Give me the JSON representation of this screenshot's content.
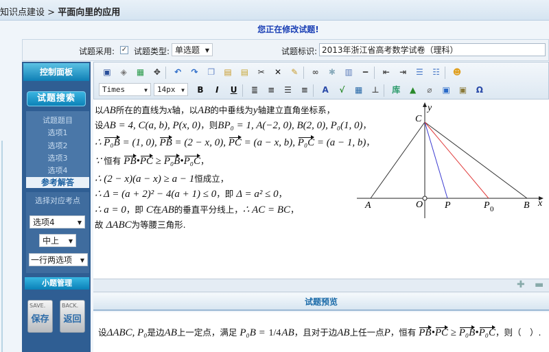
{
  "breadcrumb": {
    "parent": "知识点建设",
    "separator": " > ",
    "current": "平面向里的应用"
  },
  "page_title": "您正在修改试题!",
  "form": {
    "adopt_label": "试题采用:",
    "adopt_checked": true,
    "check_glyph": "✓",
    "type_label": "试题类型:",
    "type_value": "单选题",
    "id_label": "试题标识:",
    "id_value": "2013年浙江省高考数学试卷（理科）"
  },
  "sidebar": {
    "header": "控制面板",
    "search_button": "试题搜索",
    "items": [
      "试题题目",
      "选项1",
      "选项2",
      "选项3",
      "选项4"
    ],
    "active_item": "参考解答",
    "kp_label": "选择对应考点",
    "select_option": "选项4",
    "select_difficulty": "中上",
    "select_layout": "一行两选项",
    "sub_header": "小题管理",
    "save": {
      "en": "SAVE.",
      "cn": "保存"
    },
    "back": {
      "en": "BACK.",
      "cn": "返回"
    }
  },
  "toolbar": {
    "row1": [
      "save-icon",
      "source-icon",
      "preview-icon",
      "fullscreen-icon",
      "|",
      "undo-icon",
      "redo-icon",
      "copy-icon",
      "paste-icon",
      "paste-text-icon",
      "cut-icon",
      "delete-icon",
      "clear-format-icon",
      "|",
      "link-icon",
      "unlink-icon",
      "table-icon",
      "horizontal-rule-icon",
      "|",
      "outdent-icon",
      "indent-icon",
      "ordered-list-icon",
      "unordered-list-icon",
      "|",
      "emoticon-icon"
    ],
    "font_family": "Times",
    "font_size": "14px",
    "row2": [
      "bold-icon",
      "italic-icon",
      "underline-icon",
      "|",
      "justify-icon",
      "align-center-icon",
      "align-left-icon",
      "align-right-icon",
      "|",
      "font-color-icon",
      "formula-icon",
      "image-grid-icon",
      "page-break-icon",
      "|",
      "library-icon",
      "insert-image-icon",
      "attachment-icon",
      "media-icon",
      "picture-icon",
      "special-char-icon"
    ]
  },
  "solution_lines": [
    [
      [
        "c",
        "以"
      ],
      [
        "m",
        "AB"
      ],
      [
        "c",
        "所在的直线为"
      ],
      [
        "m",
        "x"
      ],
      [
        "c",
        "轴，以"
      ],
      [
        "m",
        "AB"
      ],
      [
        "c",
        "的中垂线为"
      ],
      [
        "m",
        "y"
      ],
      [
        "c",
        "轴建立直角坐标系，"
      ]
    ],
    [
      [
        "c",
        "设"
      ],
      [
        "m",
        "AB = 4, C(a, b), P(x, 0)"
      ],
      [
        "c",
        "，则"
      ],
      [
        "m",
        "BP₀ = 1, A(−2, 0), B(2, 0), P₀(1, 0)"
      ],
      [
        "c",
        "，"
      ]
    ],
    [
      [
        "m",
        "∴ "
      ],
      [
        "v",
        "P₀B"
      ],
      [
        "m",
        " = (1, 0), "
      ],
      [
        "v",
        "PB"
      ],
      [
        "m",
        " = (2 − x, 0), "
      ],
      [
        "v",
        "PC"
      ],
      [
        "m",
        " = (a − x, b), "
      ],
      [
        "v",
        "P₀C"
      ],
      [
        "m",
        " = (a − 1, b)"
      ],
      [
        "c",
        "，"
      ]
    ],
    [
      [
        "m",
        "∵ "
      ],
      [
        "c",
        "恒有 "
      ],
      [
        "v",
        "PB"
      ],
      [
        "m",
        "•"
      ],
      [
        "v",
        "PC"
      ],
      [
        "m",
        " ≥ "
      ],
      [
        "v",
        "P₀B"
      ],
      [
        "m",
        "•"
      ],
      [
        "v",
        "P₀C"
      ],
      [
        "c",
        "，"
      ]
    ],
    [
      [
        "m",
        "∴ (2 − x)(a − x) ≥ a − 1"
      ],
      [
        "c",
        "恒成立，"
      ]
    ],
    [
      [
        "m",
        "∴ Δ = (a + 2)² − 4(a + 1) ≤ 0"
      ],
      [
        "c",
        "，即 "
      ],
      [
        "m",
        "Δ = a² ≤ 0"
      ],
      [
        "c",
        "，"
      ]
    ],
    [
      [
        "m",
        "∴ a = 0"
      ],
      [
        "c",
        "，即 "
      ],
      [
        "m",
        "C"
      ],
      [
        "c",
        "在"
      ],
      [
        "m",
        "AB"
      ],
      [
        "c",
        "的垂直平分线上，"
      ],
      [
        "m",
        "∴ AC = BC"
      ],
      [
        "c",
        "，"
      ]
    ],
    [
      [
        "c",
        "故 "
      ],
      [
        "m",
        "ΔABC"
      ],
      [
        "c",
        "为等腰三角形."
      ]
    ]
  ],
  "figure": {
    "labels": {
      "A": "A",
      "O": "O",
      "P": "P",
      "P0": "P",
      "P0_sub": "0",
      "B": "B",
      "C": "C",
      "x": "x",
      "y": "y"
    },
    "colors": {
      "PC": "#3a3ad0",
      "P0C": "#e03a3a",
      "triangle": "#333333"
    }
  },
  "preview": {
    "header": "试题预览",
    "question": [
      [
        "c",
        "设"
      ],
      [
        "m",
        "ΔABC, P₀"
      ],
      [
        "c",
        "是边"
      ],
      [
        "m",
        "AB"
      ],
      [
        "c",
        "上一定点，满足 "
      ],
      [
        "m",
        "P₀B = "
      ],
      [
        "f",
        "1/4"
      ],
      [
        "m",
        "AB"
      ],
      [
        "c",
        "，且对于边"
      ],
      [
        "m",
        "AB"
      ],
      [
        "c",
        "上任一点"
      ],
      [
        "m",
        "P"
      ],
      [
        "c",
        "，恒有 "
      ],
      [
        "v",
        "PB"
      ],
      [
        "m",
        "•"
      ],
      [
        "v",
        "PC"
      ],
      [
        "m",
        " ≥ "
      ],
      [
        "v",
        "P₀B"
      ],
      [
        "m",
        "•"
      ],
      [
        "v",
        "P₀C"
      ],
      [
        "c",
        "，则（　）."
      ]
    ]
  }
}
